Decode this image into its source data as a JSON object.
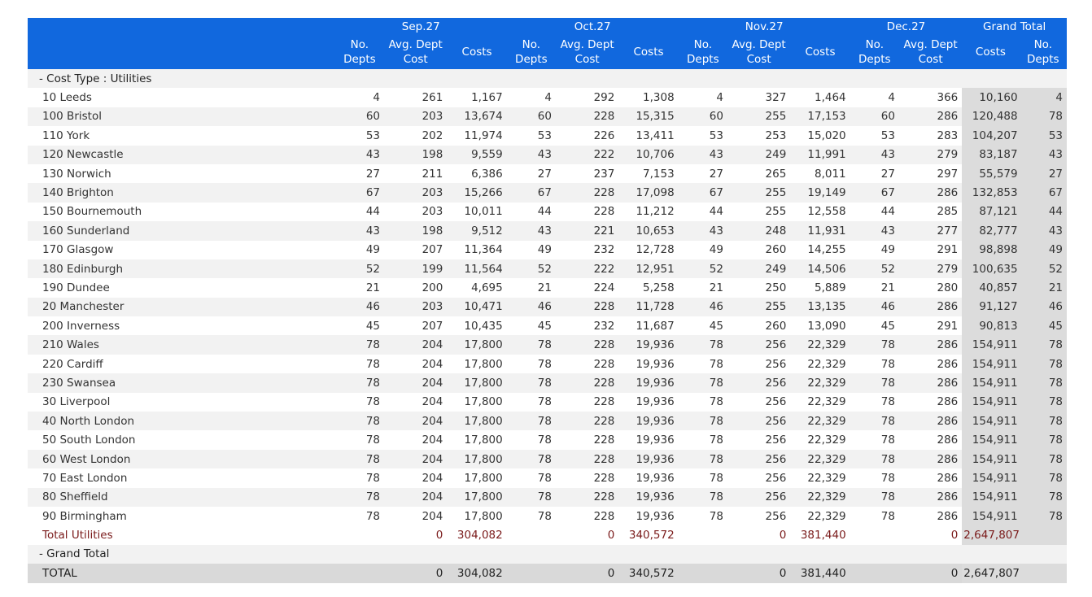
{
  "header": {
    "months": [
      "Sep.27",
      "Oct.27",
      "Nov.27",
      "Dec.27"
    ],
    "grand_total": "Grand Total",
    "sub": [
      "No.\nDepts",
      "Avg. Dept\nCost",
      "Costs"
    ],
    "grand_sub": [
      "Costs",
      "No.\nDepts"
    ]
  },
  "section_label": "- Cost Type : Utilities",
  "rows": [
    {
      "label": "10 Leeds",
      "v": [
        "4",
        "261",
        "1,167",
        "4",
        "292",
        "1,308",
        "4",
        "327",
        "1,464",
        "4",
        "366",
        "10,160",
        "4"
      ]
    },
    {
      "label": "100 Bristol",
      "v": [
        "60",
        "203",
        "13,674",
        "60",
        "228",
        "15,315",
        "60",
        "255",
        "17,153",
        "60",
        "286",
        "120,488",
        "78"
      ]
    },
    {
      "label": "110 York",
      "v": [
        "53",
        "202",
        "11,974",
        "53",
        "226",
        "13,411",
        "53",
        "253",
        "15,020",
        "53",
        "283",
        "104,207",
        "53"
      ]
    },
    {
      "label": "120 Newcastle",
      "v": [
        "43",
        "198",
        "9,559",
        "43",
        "222",
        "10,706",
        "43",
        "249",
        "11,991",
        "43",
        "279",
        "83,187",
        "43"
      ]
    },
    {
      "label": "130 Norwich",
      "v": [
        "27",
        "211",
        "6,386",
        "27",
        "237",
        "7,153",
        "27",
        "265",
        "8,011",
        "27",
        "297",
        "55,579",
        "27"
      ]
    },
    {
      "label": "140 Brighton",
      "v": [
        "67",
        "203",
        "15,266",
        "67",
        "228",
        "17,098",
        "67",
        "255",
        "19,149",
        "67",
        "286",
        "132,853",
        "67"
      ]
    },
    {
      "label": "150 Bournemouth",
      "v": [
        "44",
        "203",
        "10,011",
        "44",
        "228",
        "11,212",
        "44",
        "255",
        "12,558",
        "44",
        "285",
        "87,121",
        "44"
      ]
    },
    {
      "label": "160 Sunderland",
      "v": [
        "43",
        "198",
        "9,512",
        "43",
        "221",
        "10,653",
        "43",
        "248",
        "11,931",
        "43",
        "277",
        "82,777",
        "43"
      ]
    },
    {
      "label": "170 Glasgow",
      "v": [
        "49",
        "207",
        "11,364",
        "49",
        "232",
        "12,728",
        "49",
        "260",
        "14,255",
        "49",
        "291",
        "98,898",
        "49"
      ]
    },
    {
      "label": "180 Edinburgh",
      "v": [
        "52",
        "199",
        "11,564",
        "52",
        "222",
        "12,951",
        "52",
        "249",
        "14,506",
        "52",
        "279",
        "100,635",
        "52"
      ]
    },
    {
      "label": "190 Dundee",
      "v": [
        "21",
        "200",
        "4,695",
        "21",
        "224",
        "5,258",
        "21",
        "250",
        "5,889",
        "21",
        "280",
        "40,857",
        "21"
      ]
    },
    {
      "label": "20 Manchester",
      "v": [
        "46",
        "203",
        "10,471",
        "46",
        "228",
        "11,728",
        "46",
        "255",
        "13,135",
        "46",
        "286",
        "91,127",
        "46"
      ]
    },
    {
      "label": "200 Inverness",
      "v": [
        "45",
        "207",
        "10,435",
        "45",
        "232",
        "11,687",
        "45",
        "260",
        "13,090",
        "45",
        "291",
        "90,813",
        "45"
      ]
    },
    {
      "label": "210 Wales",
      "v": [
        "78",
        "204",
        "17,800",
        "78",
        "228",
        "19,936",
        "78",
        "256",
        "22,329",
        "78",
        "286",
        "154,911",
        "78"
      ]
    },
    {
      "label": "220 Cardiff",
      "v": [
        "78",
        "204",
        "17,800",
        "78",
        "228",
        "19,936",
        "78",
        "256",
        "22,329",
        "78",
        "286",
        "154,911",
        "78"
      ]
    },
    {
      "label": "230 Swansea",
      "v": [
        "78",
        "204",
        "17,800",
        "78",
        "228",
        "19,936",
        "78",
        "256",
        "22,329",
        "78",
        "286",
        "154,911",
        "78"
      ]
    },
    {
      "label": "30 Liverpool",
      "v": [
        "78",
        "204",
        "17,800",
        "78",
        "228",
        "19,936",
        "78",
        "256",
        "22,329",
        "78",
        "286",
        "154,911",
        "78"
      ]
    },
    {
      "label": "40 North London",
      "v": [
        "78",
        "204",
        "17,800",
        "78",
        "228",
        "19,936",
        "78",
        "256",
        "22,329",
        "78",
        "286",
        "154,911",
        "78"
      ]
    },
    {
      "label": "50 South London",
      "v": [
        "78",
        "204",
        "17,800",
        "78",
        "228",
        "19,936",
        "78",
        "256",
        "22,329",
        "78",
        "286",
        "154,911",
        "78"
      ]
    },
    {
      "label": "60 West London",
      "v": [
        "78",
        "204",
        "17,800",
        "78",
        "228",
        "19,936",
        "78",
        "256",
        "22,329",
        "78",
        "286",
        "154,911",
        "78"
      ]
    },
    {
      "label": "70 East London",
      "v": [
        "78",
        "204",
        "17,800",
        "78",
        "228",
        "19,936",
        "78",
        "256",
        "22,329",
        "78",
        "286",
        "154,911",
        "78"
      ]
    },
    {
      "label": "80 Sheffield",
      "v": [
        "78",
        "204",
        "17,800",
        "78",
        "228",
        "19,936",
        "78",
        "256",
        "22,329",
        "78",
        "286",
        "154,911",
        "78"
      ]
    },
    {
      "label": "90 Birmingham",
      "v": [
        "78",
        "204",
        "17,800",
        "78",
        "228",
        "19,936",
        "78",
        "256",
        "22,329",
        "78",
        "286",
        "154,911",
        "78"
      ]
    }
  ],
  "total_utilities": {
    "label": "Total Utilities",
    "v": [
      "",
      "0",
      "304,082",
      "",
      "0",
      "340,572",
      "",
      "0",
      "381,440",
      "",
      "0",
      "2,647,807",
      ""
    ]
  },
  "grand_section_label": "- Grand Total",
  "grand_total_row": {
    "label": "TOTAL",
    "v": [
      "",
      "0",
      "304,082",
      "",
      "0",
      "340,572",
      "",
      "0",
      "381,440",
      "",
      "0",
      "2,647,807",
      ""
    ]
  },
  "colors": {
    "header_bg": "#1168de",
    "header_text": "#ffffff",
    "zebra": "#f2f2f2",
    "grand_col": "#dcdcdc",
    "total_text": "#7a1a1a"
  }
}
